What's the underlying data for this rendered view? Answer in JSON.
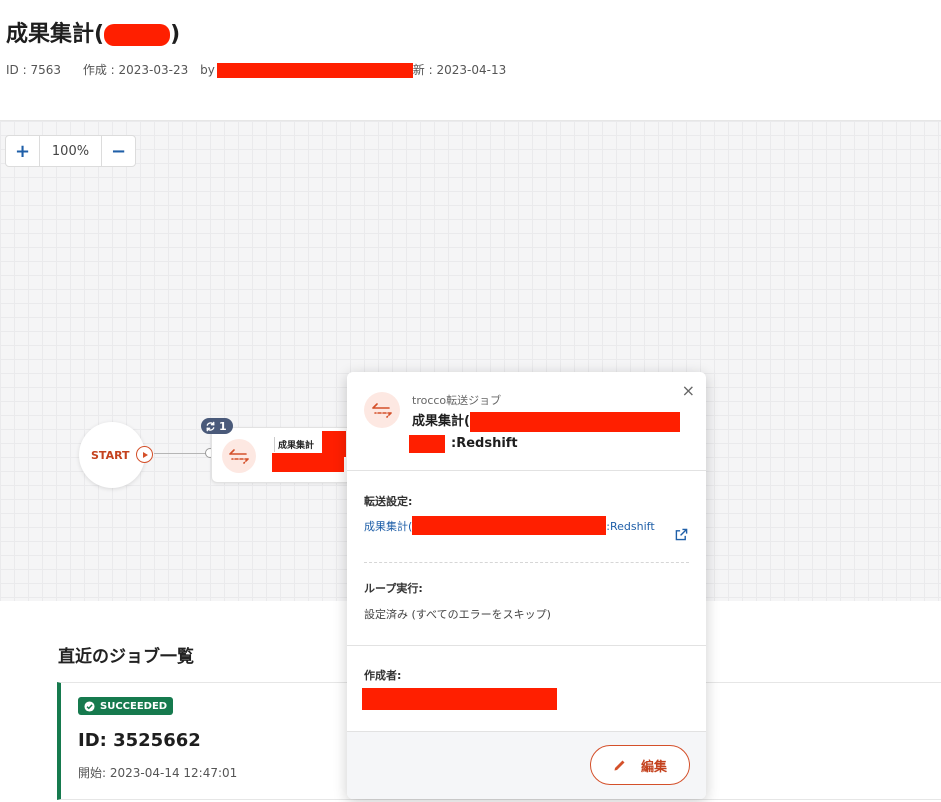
{
  "header": {
    "title_prefix": "成果集計(",
    "title_suffix": ")",
    "id_text": "ID : 7563",
    "created_text": "作成 : 2023-03-23",
    "by_prefix": "by",
    "updated_text": "新 : 2023-04-13"
  },
  "zoom": {
    "plus_label": "+",
    "level": "100%",
    "minus_label": "−"
  },
  "canvas": {
    "start_label": "START",
    "loop_count": "1",
    "node_label": "成果集計"
  },
  "popup": {
    "close_label": "×",
    "job_type": "trocco転送ジョブ",
    "job_name_prefix": "成果集計(",
    "job_name_suffix": ":Redshift",
    "transfer_label": "転送設定:",
    "transfer_link_prefix": "成果集計(",
    "transfer_link_suffix": ":Redshift",
    "loop_label": "ループ実行:",
    "loop_value": "設定済み (すべてのエラーをスキップ)",
    "creator_label": "作成者:",
    "edit_label": "編集"
  },
  "jobs": {
    "title": "直近のジョブ一覧",
    "items": [
      {
        "status": "SUCCEEDED",
        "id_text": "ID: 3525662",
        "start_text": "開始: 2023-04-14 12:47:01"
      }
    ]
  },
  "colors": {
    "accent": "#d4502a",
    "redaction": "#ff1f00",
    "success": "#167a4e",
    "link": "#1f5fa8"
  },
  "icons": [
    "transfer-icon",
    "loop-icon",
    "play-icon",
    "close-icon",
    "external-link-icon",
    "pencil-icon",
    "check-circle-icon"
  ]
}
